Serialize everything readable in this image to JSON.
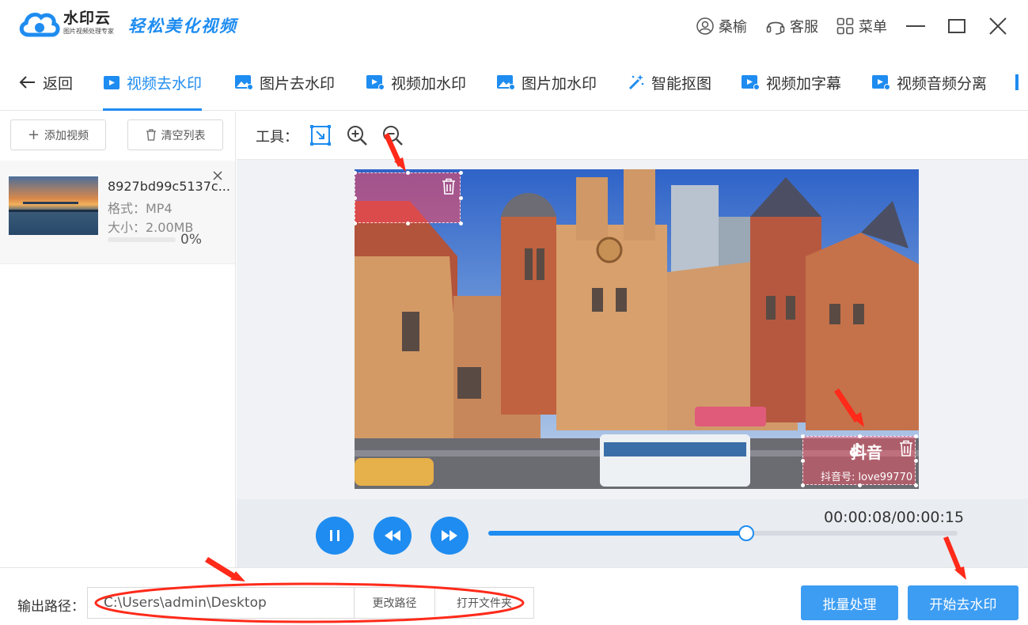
{
  "app": {
    "logo_name": "水印云",
    "logo_subtitle": "图片视频处理专家",
    "slogan": "轻松美化视频",
    "user_name": "桑榆",
    "service_label": "客服",
    "menu_label": "菜单"
  },
  "nav": {
    "back_label": "返回",
    "tabs": [
      {
        "label": "视频去水印",
        "icon": "video-icon",
        "active": true
      },
      {
        "label": "图片去水印",
        "icon": "image-icon"
      },
      {
        "label": "视频加水印",
        "icon": "video-add-icon"
      },
      {
        "label": "图片加水印",
        "icon": "image-add-icon"
      },
      {
        "label": "智能抠图",
        "icon": "magic-wand-icon"
      },
      {
        "label": "视频加字幕",
        "icon": "subtitle-icon"
      },
      {
        "label": "视频音频分离",
        "icon": "audio-split-icon"
      }
    ]
  },
  "sidebar": {
    "add_label": "添加视频",
    "clear_label": "清空列表",
    "file": {
      "name": "8927bd99c5137c...",
      "format": "格式：MP4",
      "size": "大小：2.00MB",
      "progress_pct": "0%",
      "progress": 0
    }
  },
  "tools": {
    "label": "工具：",
    "icons": [
      "select-box-icon",
      "zoom-in-icon",
      "zoom-out-icon"
    ]
  },
  "video": {
    "watermark_logo_text": "抖音",
    "watermark_id_text": "抖音号: love99770"
  },
  "player": {
    "time": "00:00:08/00:00:15",
    "progress": 0.55
  },
  "output": {
    "label": "输出路径：",
    "path": "C:\\Users\\admin\\Desktop",
    "change_label": "更改路径",
    "open_label": "打开文件夹",
    "batch_label": "批量处理",
    "start_label": "开始去水印"
  },
  "colors": {
    "accent": "#1e8cf0",
    "primary_button": "#3d9df3",
    "annotation": "#ff2a1a"
  }
}
